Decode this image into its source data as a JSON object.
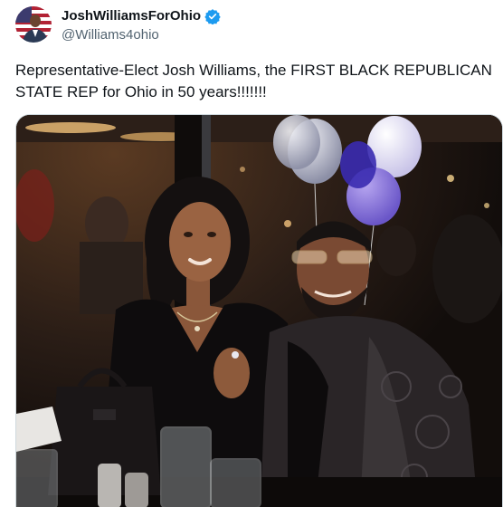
{
  "author": {
    "display_name": "JoshWilliamsForOhio",
    "handle": "@Williams4ohio",
    "verified": true,
    "badge_color": "#1d9bf0"
  },
  "tweet": {
    "text": "Representative-Elect Josh Williams, the FIRST BLACK REPUBLICAN STATE REP for Ohio in 50 years!!!!!!!"
  },
  "icons": {
    "avatar": "avatar-with-flag",
    "verified": "verified-badge-icon"
  },
  "colors": {
    "text_primary": "#0f1419",
    "text_secondary": "#536471",
    "accent": "#1d9bf0",
    "media_border": "#cfd9de"
  }
}
